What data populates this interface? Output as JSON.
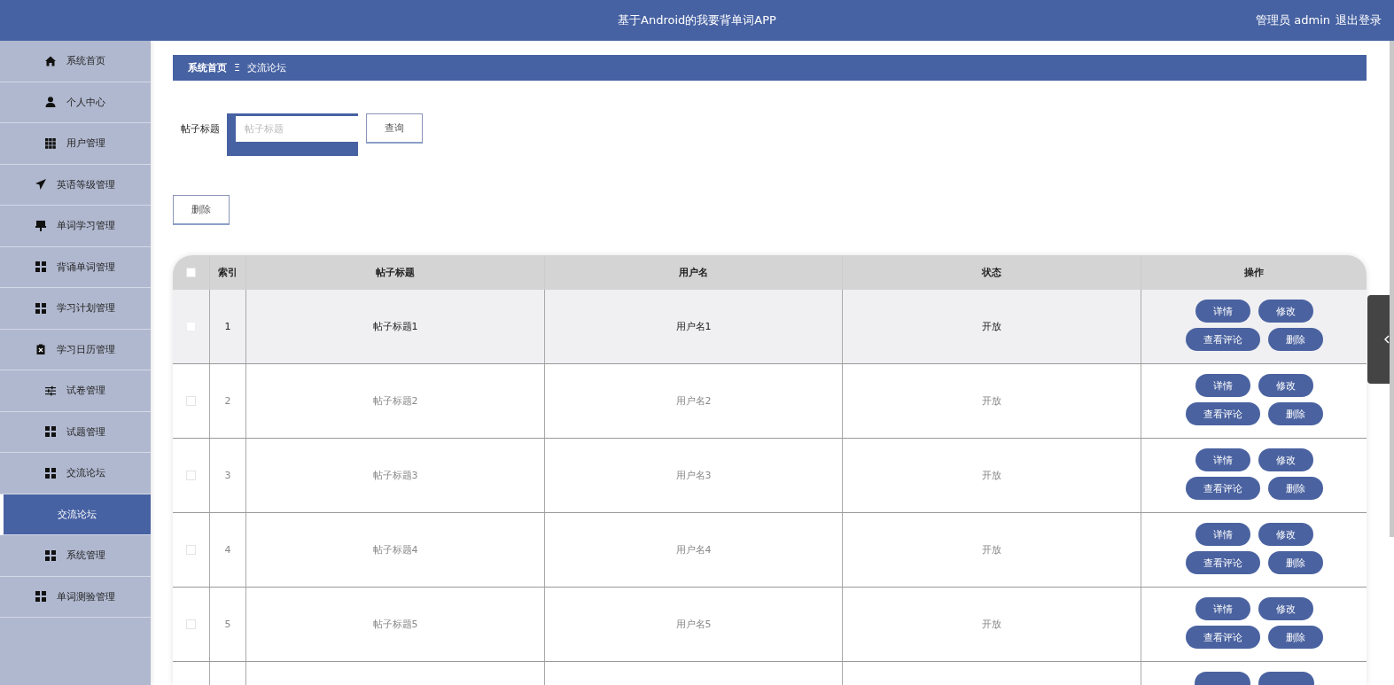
{
  "header": {
    "title": "基于Android的我要背单词APP",
    "user": "管理员 admin",
    "logout": "退出登录"
  },
  "sidebar": {
    "items": [
      {
        "label": "系统首页",
        "kind": "menu",
        "selected": false
      },
      {
        "label": "个人中心",
        "kind": "menu",
        "selected": false
      },
      {
        "label": "用户管理",
        "kind": "menu",
        "selected": false
      },
      {
        "label": "英语等级管理",
        "kind": "menu",
        "selected": false
      },
      {
        "label": "单词学习管理",
        "kind": "menu",
        "selected": false
      },
      {
        "label": "背诵单词管理",
        "kind": "menu",
        "selected": false
      },
      {
        "label": "学习计划管理",
        "kind": "menu",
        "selected": false
      },
      {
        "label": "学习日历管理",
        "kind": "menu",
        "selected": false
      },
      {
        "label": "试卷管理",
        "kind": "menu",
        "selected": false
      },
      {
        "label": "试题管理",
        "kind": "menu",
        "selected": false
      },
      {
        "label": "交流论坛",
        "kind": "menu",
        "selected": false
      },
      {
        "label": "交流论坛",
        "kind": "submenu",
        "selected": true
      },
      {
        "label": "系统管理",
        "kind": "menu",
        "selected": false
      },
      {
        "label": "单词测验管理",
        "kind": "menu",
        "selected": false
      }
    ]
  },
  "breadcrumb": {
    "home": "系统首页",
    "separator": "Ξ",
    "current": "交流论坛"
  },
  "search": {
    "label": "帖子标题",
    "placeholder": "帖子标题",
    "button": "查询"
  },
  "delete_button": "删除",
  "table": {
    "columns": [
      "索引",
      "帖子标题",
      "用户名",
      "状态",
      "操作"
    ],
    "header_checked": false,
    "rows": [
      {
        "index": "1",
        "title": "帖子标题1",
        "user": "用户名1",
        "status": "开放",
        "highlighted": true,
        "checked": false,
        "actions": [
          "详情",
          "修改",
          "查看评论",
          "删除"
        ]
      },
      {
        "index": "2",
        "title": "帖子标题2",
        "user": "用户名2",
        "status": "开放",
        "highlighted": false,
        "checked": false,
        "actions": [
          "详情",
          "修改",
          "查看评论",
          "删除"
        ]
      },
      {
        "index": "3",
        "title": "帖子标题3",
        "user": "用户名3",
        "status": "开放",
        "highlighted": false,
        "checked": false,
        "actions": [
          "详情",
          "修改",
          "查看评论",
          "删除"
        ]
      },
      {
        "index": "4",
        "title": "帖子标题4",
        "user": "用户名4",
        "status": "开放",
        "highlighted": false,
        "checked": false,
        "actions": [
          "详情",
          "修改",
          "查看评论",
          "删除"
        ]
      },
      {
        "index": "5",
        "title": "帖子标题5",
        "user": "用户名5",
        "status": "开放",
        "highlighted": false,
        "checked": false,
        "actions": [
          "详情",
          "修改",
          "查看评论",
          "删除"
        ]
      },
      {
        "kind": "partial",
        "highlighted": false
      }
    ]
  }
}
